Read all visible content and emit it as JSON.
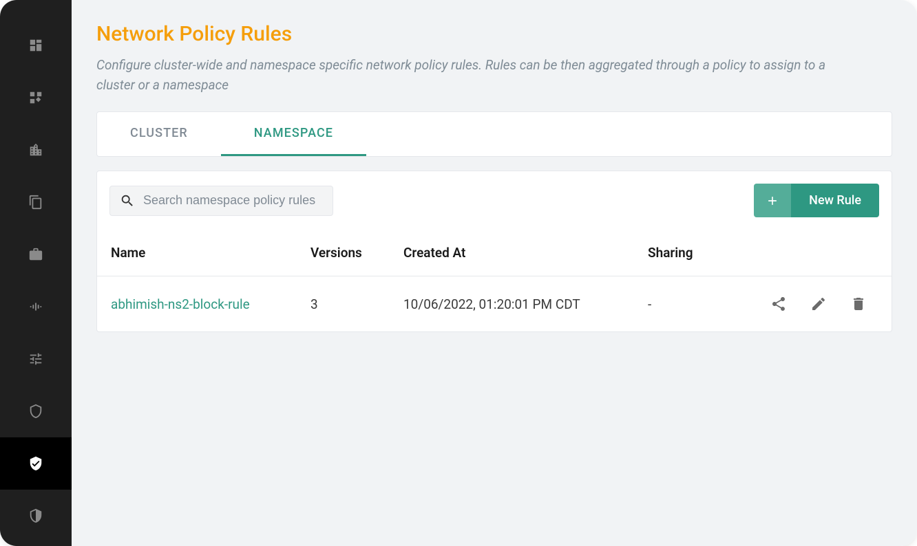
{
  "page": {
    "title": "Network Policy Rules",
    "description": "Configure cluster-wide and namespace specific network policy rules. Rules can be then aggregated through a policy to assign to a cluster or a namespace"
  },
  "tabs": {
    "cluster": "CLUSTER",
    "namespace": "NAMESPACE"
  },
  "search": {
    "placeholder": "Search namespace policy rules"
  },
  "button": {
    "new_rule": "New Rule"
  },
  "table": {
    "headers": {
      "name": "Name",
      "versions": "Versions",
      "created_at": "Created At",
      "sharing": "Sharing"
    },
    "rows": [
      {
        "name": "abhimish-ns2-block-rule",
        "versions": "3",
        "created_at": "10/06/2022, 01:20:01 PM CDT",
        "sharing": "-"
      }
    ]
  }
}
